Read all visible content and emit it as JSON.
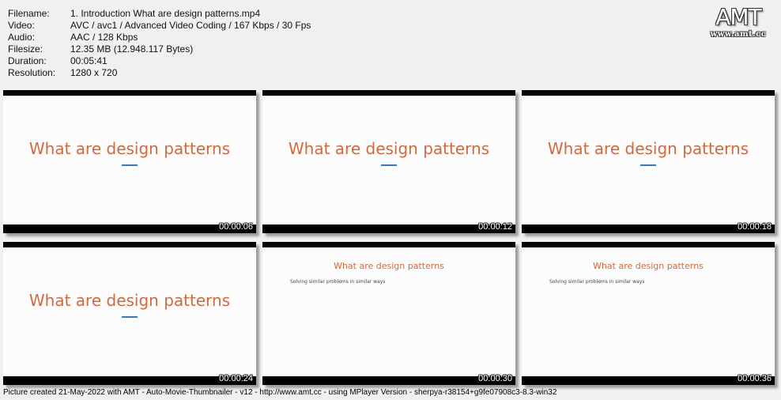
{
  "info": {
    "rows": [
      {
        "label": "Filename:",
        "value": "1. Introduction What are design patterns.mp4"
      },
      {
        "label": "Video:",
        "value": "AVC / avc1 / Advanced Video Coding / 167 Kbps / 30 Fps"
      },
      {
        "label": "Audio:",
        "value": "AAC / 128 Kbps"
      },
      {
        "label": "Filesize:",
        "value": "12.35 MB (12.948.117 Bytes)"
      },
      {
        "label": "Duration:",
        "value": "00:05:41"
      },
      {
        "label": "Resolution:",
        "value": "1280 x 720"
      }
    ]
  },
  "logo": {
    "mark": "AMT",
    "url": "www.amt.cc"
  },
  "thumbnails": [
    {
      "title": "What are design patterns",
      "subtitle": "",
      "timestamp": "00:00:06"
    },
    {
      "title": "What are design patterns",
      "subtitle": "",
      "timestamp": "00:00:12"
    },
    {
      "title": "What are design patterns",
      "subtitle": "",
      "timestamp": "00:00:18"
    },
    {
      "title": "What are design patterns",
      "subtitle": "",
      "timestamp": "00:00:24"
    },
    {
      "title": "What are design patterns",
      "subtitle": "Solving similar problems in similar ways",
      "timestamp": "00:00:30"
    },
    {
      "title": "What are design patterns",
      "subtitle": "Solving similar problems in similar ways",
      "timestamp": "00:00:36"
    }
  ],
  "footer": "Picture created 21-May-2022 with AMT - Auto-Movie-Thumbnailer - v12 - http://www.amt.cc - using MPlayer Version - sherpya-r38154+g9fe07908c3-8.3-win32",
  "colors": {
    "slide_title": "#cf6a3e",
    "underline": "#3d73c6",
    "background": "#f0f0f0"
  }
}
